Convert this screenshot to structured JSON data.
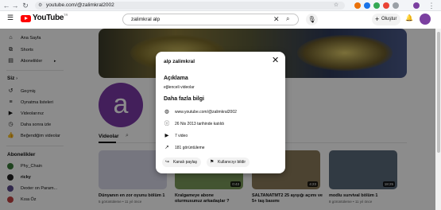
{
  "browser": {
    "url": "youtube.com/@zalimkral2002"
  },
  "header": {
    "logo_text": "YouTube",
    "logo_region": "TR",
    "search_value": "zalimkral alp",
    "create_label": "Oluştur"
  },
  "sidebar": {
    "main": [
      {
        "label": "Ana Sayfa",
        "icon": "home-icon"
      },
      {
        "label": "Shorts",
        "icon": "shorts-icon"
      },
      {
        "label": "Abonelikler",
        "icon": "subscriptions-icon"
      }
    ],
    "you_heading": "Siz",
    "you": [
      {
        "label": "Geçmiş",
        "icon": "history-icon"
      },
      {
        "label": "Oynatma listeleri",
        "icon": "playlists-icon"
      },
      {
        "label": "Videolarınız",
        "icon": "your-videos-icon"
      },
      {
        "label": "Daha sonra izle",
        "icon": "watch-later-icon"
      },
      {
        "label": "Beğendiğim videolar",
        "icon": "liked-icon"
      }
    ],
    "subs_heading": "Abonelikler",
    "subs": [
      {
        "label": "Phy_Chain",
        "color": "#3a7a3a"
      },
      {
        "label": "ricky",
        "color": "#222222"
      },
      {
        "label": "Dexter on Param...",
        "color": "#5a4a8a"
      },
      {
        "label": "Kısa Öz",
        "color": "#c04040"
      }
    ]
  },
  "channel": {
    "avatar_letter": "a",
    "tab_videos": "Videolar"
  },
  "videos": [
    {
      "title": "Dünyanın en zor oyunu bölüm 1",
      "meta": "5 görüntüleme • 11 yıl önce",
      "thumb": "#d8d8e8"
    },
    {
      "title": "Kralgameye abone olurmusunuz arkadaşlar ?",
      "meta": "",
      "duration": "0:43",
      "thumb": "#7a9a5a"
    },
    {
      "title": "SALTANATMT2 25 ayışığı açımı ve 5+ taş basımı",
      "meta": "16 görüntüleme • 11 yıl önce",
      "duration": "4:23",
      "thumb": "#8a7a5a"
    },
    {
      "title": "modlu survival bölüm 1",
      "meta": "8 görüntüleme • 11 yıl önce",
      "duration": "18:25",
      "thumb": "#5a6a7a"
    }
  ],
  "dialog": {
    "title": "alp zalimkral",
    "description_heading": "Açıklama",
    "description": "eğlenceli videolar",
    "more_info_heading": "Daha fazla bilgi",
    "rows": [
      {
        "icon": "globe-icon",
        "text": "www.youtube.com/@zalimkral2002"
      },
      {
        "icon": "info-icon",
        "text": "26 Nis 2013 tarihinde katıldı"
      },
      {
        "icon": "video-icon",
        "text": "7 video"
      },
      {
        "icon": "trending-icon",
        "text": "181 görüntüleme"
      }
    ],
    "share_label": "Kanalı paylaş",
    "report_label": "Kullanıcıyı bildir"
  }
}
